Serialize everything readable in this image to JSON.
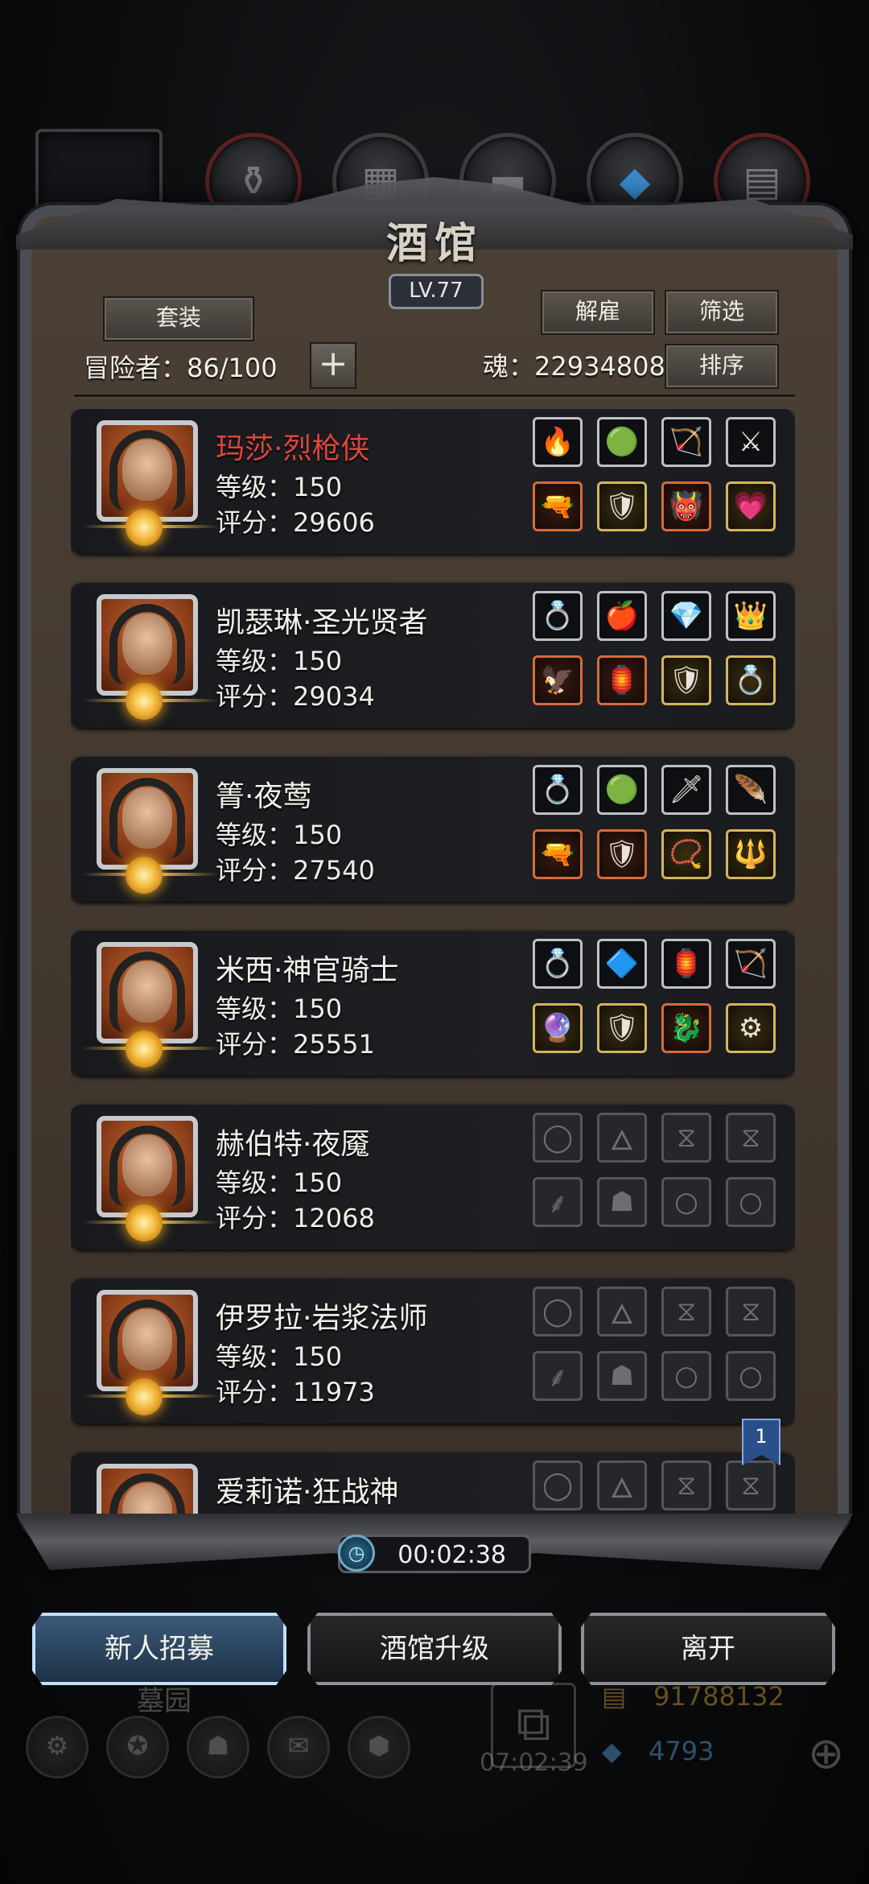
{
  "window": {
    "title": "酒馆",
    "level": "LV.77"
  },
  "top_tabs": [
    {
      "icon": "knight-helmet-icon"
    },
    {
      "icon": "potion-icon"
    },
    {
      "icon": "scroll-icon"
    },
    {
      "icon": "anvil-icon"
    },
    {
      "icon": "crystal-icon"
    },
    {
      "icon": "armor-icon"
    }
  ],
  "header": {
    "set_button": "套装",
    "dismiss_button": "解雇",
    "filter_button": "筛选",
    "sort_button": "排序",
    "adventurers": "冒险者：86/100",
    "souls": "魂：22934808"
  },
  "heroes": [
    {
      "name": "玛莎·烈枪侠",
      "level": "等级：150",
      "score": "评分：29606",
      "highlight": true,
      "equip": [
        "🔥",
        "🟢",
        "🏹",
        "⚔",
        "🔫",
        "🛡",
        "👹",
        "💗"
      ],
      "tiers": [
        "white",
        "white",
        "white",
        "white",
        "orange",
        "gold",
        "orange",
        "gold"
      ]
    },
    {
      "name": "凯瑟琳·圣光贤者",
      "level": "等级：150",
      "score": "评分：29034",
      "highlight": false,
      "equip": [
        "💍",
        "🍎",
        "💎",
        "👑",
        "🦅",
        "🏮",
        "🛡",
        "💍"
      ],
      "tiers": [
        "white",
        "white",
        "white",
        "white",
        "orange",
        "orange",
        "gold",
        "gold"
      ]
    },
    {
      "name": "箐·夜莺",
      "level": "等级：150",
      "score": "评分：27540",
      "highlight": false,
      "equip": [
        "💍",
        "🟢",
        "🗡",
        "🪶",
        "🔫",
        "🛡",
        "📿",
        "🔱"
      ],
      "tiers": [
        "white",
        "white",
        "white",
        "white",
        "orange",
        "orange",
        "gold",
        "gold"
      ]
    },
    {
      "name": "米西·神官骑士",
      "level": "等级：150",
      "score": "评分：25551",
      "highlight": false,
      "equip": [
        "💍",
        "🔷",
        "🏮",
        "🏹",
        "🔮",
        "🛡",
        "🐉",
        "⚙"
      ],
      "tiers": [
        "white",
        "white",
        "white",
        "white",
        "gold",
        "gold",
        "orange",
        "gold"
      ]
    },
    {
      "name": "赫伯特·夜魇",
      "level": "等级：150",
      "score": "评分：12068",
      "highlight": false,
      "equip": [
        "◯",
        "🜂",
        "⧖",
        "⧖",
        "⸙",
        "☗",
        "○",
        "○"
      ],
      "tiers": [
        "empty",
        "empty",
        "empty",
        "empty",
        "empty",
        "empty",
        "empty",
        "empty"
      ]
    },
    {
      "name": "伊罗拉·岩浆法师",
      "level": "等级：150",
      "score": "评分：11973",
      "highlight": false,
      "equip": [
        "◯",
        "🜂",
        "⧖",
        "⧖",
        "⸙",
        "☗",
        "○",
        "○"
      ],
      "tiers": [
        "empty",
        "empty",
        "empty",
        "empty",
        "empty",
        "empty",
        "empty",
        "empty"
      ]
    },
    {
      "name": "爱莉诺·狂战神",
      "level": "",
      "score": "",
      "highlight": false,
      "equip": [
        "◯",
        "🜂",
        "⧖",
        "⧖"
      ],
      "tiers": [
        "empty",
        "empty",
        "empty",
        "empty"
      ]
    }
  ],
  "page_badge": "1",
  "timer": "00:02:38",
  "actions": {
    "recruit": "新人招募",
    "upgrade": "酒馆升级",
    "leave": "离开"
  },
  "background": {
    "area_label": "墓园",
    "gift_timer": "07:02:39",
    "gold": "91788132",
    "gems": "4793"
  }
}
